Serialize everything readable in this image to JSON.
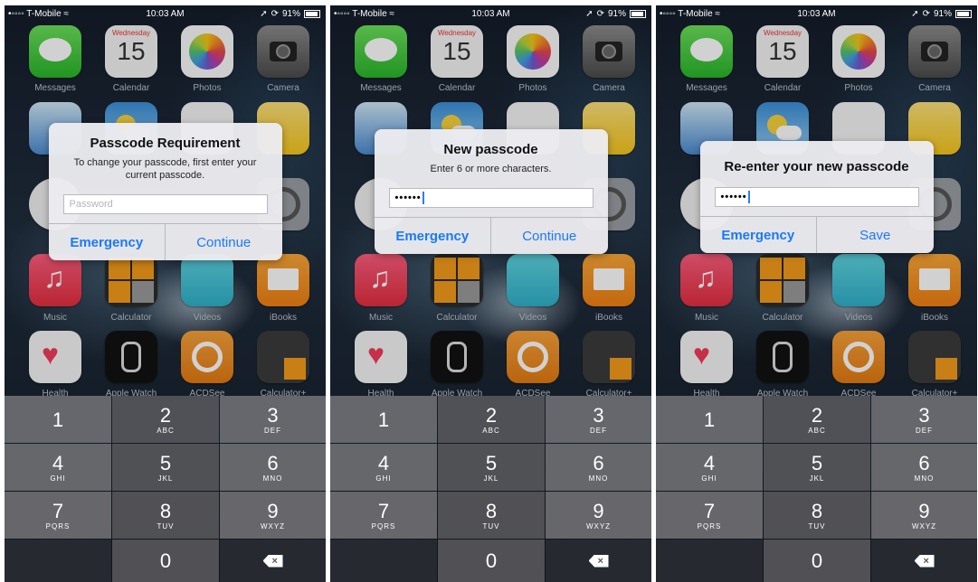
{
  "status_bar": {
    "carrier": "T-Mobile",
    "time": "10:03 AM",
    "battery": "91%"
  },
  "home_icons": {
    "messages": "Messages",
    "calendar": "Calendar",
    "calendar_day": "Wednesday",
    "calendar_date": "15",
    "photos": "Photos",
    "camera": "Camera",
    "music": "Music",
    "calculator": "Calculator",
    "videos": "Videos",
    "ibooks": "iBooks",
    "health": "Health",
    "apple_watch": "Apple Watch",
    "acdsee": "ACDSee",
    "calculator_plus": "Calculator+"
  },
  "screens": [
    {
      "dialog": {
        "title": "Passcode Requirement",
        "message": "To change your passcode, first enter your current passcode.",
        "placeholder": "Password",
        "buttons": [
          "Emergency",
          "Continue"
        ]
      }
    },
    {
      "dialog": {
        "title": "New passcode",
        "message": "Enter 6 or more characters.",
        "value": "••••••",
        "buttons": [
          "Emergency",
          "Continue"
        ]
      }
    },
    {
      "dialog": {
        "title": "Re-enter your new passcode",
        "value": "••••••",
        "buttons": [
          "Emergency",
          "Save"
        ]
      }
    }
  ],
  "keypad": {
    "keys": [
      {
        "digit": "1",
        "letters": ""
      },
      {
        "digit": "2",
        "letters": "ABC"
      },
      {
        "digit": "3",
        "letters": "DEF"
      },
      {
        "digit": "4",
        "letters": "GHI"
      },
      {
        "digit": "5",
        "letters": "JKL"
      },
      {
        "digit": "6",
        "letters": "MNO"
      },
      {
        "digit": "7",
        "letters": "PQRS"
      },
      {
        "digit": "8",
        "letters": "TUV"
      },
      {
        "digit": "9",
        "letters": "WXYZ"
      },
      {
        "digit": "0",
        "letters": ""
      }
    ]
  }
}
